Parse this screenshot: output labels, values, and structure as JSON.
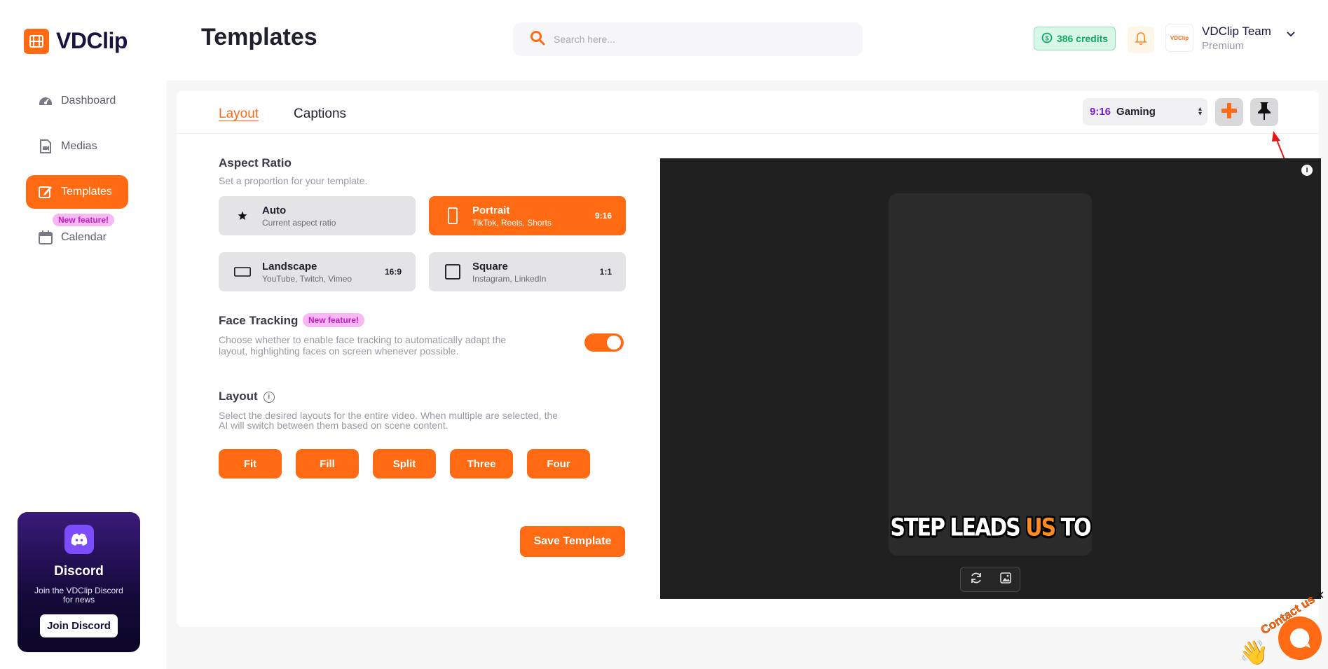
{
  "app": {
    "name": "VDClip"
  },
  "sidebar": {
    "items": [
      {
        "label": "Dashboard",
        "icon": "dashboard-icon",
        "active": false
      },
      {
        "label": "Medias",
        "icon": "medias-icon",
        "active": false
      },
      {
        "label": "Templates",
        "icon": "templates-icon",
        "active": true
      },
      {
        "label": "Calendar",
        "icon": "calendar-icon",
        "active": false,
        "badge": "New feature!"
      }
    ],
    "discord": {
      "title": "Discord",
      "subtitle": "Join the VDClip Discord for news",
      "button": "Join Discord"
    }
  },
  "header": {
    "title": "Templates",
    "search_placeholder": "Search here...",
    "credits": "386 credits",
    "user": {
      "name": "VDClip Team",
      "plan": "Premium",
      "avatar_text": "VDClip"
    }
  },
  "tabs": [
    {
      "label": "Layout",
      "active": true
    },
    {
      "label": "Captions",
      "active": false
    }
  ],
  "preset": {
    "ratio": "9:16",
    "name": "Gaming"
  },
  "aspect_ratio": {
    "title": "Aspect Ratio",
    "description": "Set a proportion for your template.",
    "options": [
      {
        "title": "Auto",
        "subtitle": "Current aspect ratio",
        "value": "",
        "active": false,
        "icon": "star-icon"
      },
      {
        "title": "Portrait",
        "subtitle": "TikTok, Reels, Shorts",
        "value": "9:16",
        "active": true,
        "icon": "portrait-icon"
      },
      {
        "title": "Landscape",
        "subtitle": "YouTube, Twitch, Vimeo",
        "value": "16:9",
        "active": false,
        "icon": "landscape-icon"
      },
      {
        "title": "Square",
        "subtitle": "Instagram, LinkedIn",
        "value": "1:1",
        "active": false,
        "icon": "square-icon"
      }
    ]
  },
  "face_tracking": {
    "title": "Face Tracking",
    "badge": "New feature!",
    "description": "Choose whether to enable face tracking to automatically adapt the layout, highlighting faces on screen whenever possible.",
    "enabled": true
  },
  "layout": {
    "title": "Layout",
    "description": "Select the desired layouts for the entire video. When multiple are selected, the AI will switch between them based on scene content.",
    "options": [
      "Fit",
      "Fill",
      "Split",
      "Three",
      "Four"
    ]
  },
  "save_label": "Save Template",
  "preview": {
    "caption_words": [
      "STEP",
      "LEADS",
      "US",
      "TO"
    ],
    "highlight_word": "US"
  },
  "contact": {
    "label": "Contact us"
  },
  "colors": {
    "accent": "#ff6a13",
    "sidebar_bg": "#ffffff",
    "preview_bg": "#202020",
    "credits": "#12a864"
  }
}
